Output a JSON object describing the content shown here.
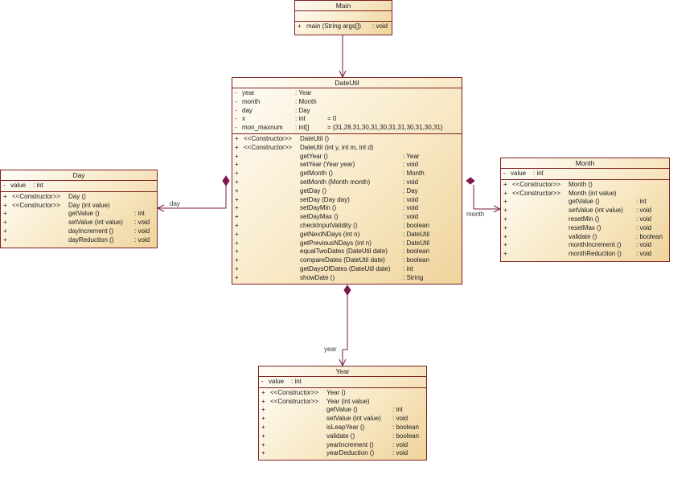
{
  "classes": {
    "main": {
      "name": "Main",
      "attributes": [],
      "operations": [
        {
          "vis": "+",
          "name": "main (String args[])",
          "type": ": void"
        }
      ]
    },
    "dateutil": {
      "name": "DateUtil",
      "attributes": [
        {
          "vis": "-",
          "name": "year",
          "type": ": Year",
          "init": ""
        },
        {
          "vis": "-",
          "name": "month",
          "type": ": Month",
          "init": ""
        },
        {
          "vis": "-",
          "name": "day",
          "type": ": Day",
          "init": ""
        },
        {
          "vis": "-",
          "name": "x",
          "type": ": int",
          "init": "= 0"
        },
        {
          "vis": "-",
          "name": "mon_maxnum",
          "type": ": int[]",
          "init": "= {31,28,31,30,31,30,31,31,30,31,30,31}"
        }
      ],
      "operations": [
        {
          "vis": "+",
          "stereo": "<<Constructor>>",
          "name": "DateUtil ()",
          "type": ""
        },
        {
          "vis": "+",
          "stereo": "<<Constructor>>",
          "name": "DateUtil (int y, int m, int d)",
          "type": ""
        },
        {
          "vis": "+",
          "stereo": "",
          "name": "getYear ()",
          "type": ": Year"
        },
        {
          "vis": "+",
          "stereo": "",
          "name": "setYear (Year year)",
          "type": ": void"
        },
        {
          "vis": "+",
          "stereo": "",
          "name": "getMonth ()",
          "type": ": Month"
        },
        {
          "vis": "+",
          "stereo": "",
          "name": "setMonth (Month month)",
          "type": ": void"
        },
        {
          "vis": "+",
          "stereo": "",
          "name": "getDay ()",
          "type": ": Day"
        },
        {
          "vis": "+",
          "stereo": "",
          "name": "setDay (Day day)",
          "type": ": void"
        },
        {
          "vis": "+",
          "stereo": "",
          "name": "setDayMin ()",
          "type": ": void"
        },
        {
          "vis": "+",
          "stereo": "",
          "name": "setDayMax ()",
          "type": ": void"
        },
        {
          "vis": "+",
          "stereo": "",
          "name": "checkInputValidity ()",
          "type": ": boolean"
        },
        {
          "vis": "+",
          "stereo": "",
          "name": "getNextNDays (int n)",
          "type": ": DateUtil"
        },
        {
          "vis": "+",
          "stereo": "",
          "name": "getPreviousNDays (int n)",
          "type": ": DateUtil"
        },
        {
          "vis": "+",
          "stereo": "",
          "name": "equalTwoDates (DateUtil date)",
          "type": ": boolean"
        },
        {
          "vis": "+",
          "stereo": "",
          "name": "compareDates (DateUtil date)",
          "type": ": boolean"
        },
        {
          "vis": "+",
          "stereo": "",
          "name": "getDaysOfDates (DateUtil date)",
          "type": ": int"
        },
        {
          "vis": "+",
          "stereo": "",
          "name": "showDate ()",
          "type": ": String"
        }
      ]
    },
    "day": {
      "name": "Day",
      "attributes": [
        {
          "vis": "-",
          "name": "value",
          "type": ": int"
        }
      ],
      "operations": [
        {
          "vis": "+",
          "stereo": "<<Constructor>>",
          "name": "Day ()",
          "type": ""
        },
        {
          "vis": "+",
          "stereo": "<<Constructor>>",
          "name": "Day (int value)",
          "type": ""
        },
        {
          "vis": "+",
          "stereo": "",
          "name": "getValue ()",
          "type": ": int"
        },
        {
          "vis": "+",
          "stereo": "",
          "name": "setValue (int value)",
          "type": ": void"
        },
        {
          "vis": "+",
          "stereo": "",
          "name": "dayIncrement ()",
          "type": ": void"
        },
        {
          "vis": "+",
          "stereo": "",
          "name": "dayReduction ()",
          "type": ": void"
        }
      ]
    },
    "month": {
      "name": "Month",
      "attributes": [
        {
          "vis": "-",
          "name": "value",
          "type": ": int"
        }
      ],
      "operations": [
        {
          "vis": "+",
          "stereo": "<<Constructor>>",
          "name": "Month ()",
          "type": ""
        },
        {
          "vis": "+",
          "stereo": "<<Constructor>>",
          "name": "Month (int value)",
          "type": ""
        },
        {
          "vis": "+",
          "stereo": "",
          "name": "getValue ()",
          "type": ": int"
        },
        {
          "vis": "+",
          "stereo": "",
          "name": "setValue (int value)",
          "type": ": void"
        },
        {
          "vis": "+",
          "stereo": "",
          "name": "resetMin ()",
          "type": ": void"
        },
        {
          "vis": "+",
          "stereo": "",
          "name": "resetMax ()",
          "type": ": void"
        },
        {
          "vis": "+",
          "stereo": "",
          "name": "validate ()",
          "type": ": boolean"
        },
        {
          "vis": "+",
          "stereo": "",
          "name": "monthIncrement ()",
          "type": ": void"
        },
        {
          "vis": "+",
          "stereo": "",
          "name": "monthReduction ()",
          "type": ": void"
        }
      ]
    },
    "year": {
      "name": "Year",
      "attributes": [
        {
          "vis": "-",
          "name": "value",
          "type": ": int"
        }
      ],
      "operations": [
        {
          "vis": "+",
          "stereo": "<<Constructor>>",
          "name": "Year ()",
          "type": ""
        },
        {
          "vis": "+",
          "stereo": "<<Constructor>>",
          "name": "Year (int value)",
          "type": ""
        },
        {
          "vis": "+",
          "stereo": "",
          "name": "getValue ()",
          "type": ": int"
        },
        {
          "vis": "+",
          "stereo": "",
          "name": "setValue (int value)",
          "type": ": void"
        },
        {
          "vis": "+",
          "stereo": "",
          "name": "isLeapYear ()",
          "type": ": boolean"
        },
        {
          "vis": "+",
          "stereo": "",
          "name": "validate ()",
          "type": ": boolean"
        },
        {
          "vis": "+",
          "stereo": "",
          "name": "yearIncrement ()",
          "type": ": void"
        },
        {
          "vis": "+",
          "stereo": "",
          "name": "yearDeduction ()",
          "type": ": void"
        }
      ]
    }
  },
  "links": {
    "day": "day",
    "month": "month",
    "year": "year"
  },
  "colors": {
    "border": "#7d2020",
    "edge": "#7b1a4a"
  }
}
